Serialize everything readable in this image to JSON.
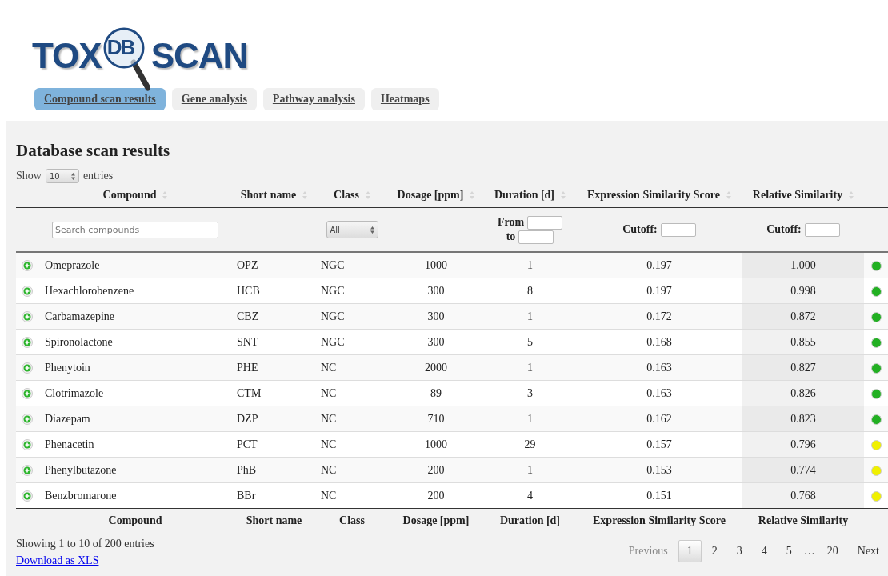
{
  "logo": {
    "left": "TOX",
    "middle": "DB",
    "right": "SCAN"
  },
  "tabs": [
    {
      "label": "Compound scan results",
      "selected": true
    },
    {
      "label": "Gene analysis",
      "selected": false
    },
    {
      "label": "Pathway analysis",
      "selected": false
    },
    {
      "label": "Heatmaps",
      "selected": false
    }
  ],
  "title": "Database scan results",
  "length_menu": {
    "before": "Show",
    "value": "10",
    "after": "entries"
  },
  "table": {
    "columns": [
      "Compound",
      "Short name",
      "Class",
      "Dosage [ppm]",
      "Duration [d]",
      "Expression Similarity Score",
      "Relative Similarity"
    ],
    "filters": {
      "search_placeholder": "Search compounds",
      "class_value": "All",
      "from_label": "From",
      "to_label": "to",
      "cutoff_label_1": "Cutoff:",
      "cutoff_label_2": "Cutoff:"
    },
    "rows": [
      {
        "compound": "Omeprazole",
        "short": "OPZ",
        "class": "NGC",
        "dosage": "1000",
        "duration": "1",
        "score": "0.197",
        "relative": "1.000",
        "color": "#22b022"
      },
      {
        "compound": "Hexachlorobenzene",
        "short": "HCB",
        "class": "NGC",
        "dosage": "300",
        "duration": "8",
        "score": "0.197",
        "relative": "0.998",
        "color": "#22b022"
      },
      {
        "compound": "Carbamazepine",
        "short": "CBZ",
        "class": "NGC",
        "dosage": "300",
        "duration": "1",
        "score": "0.172",
        "relative": "0.872",
        "color": "#22b022"
      },
      {
        "compound": "Spironolactone",
        "short": "SNT",
        "class": "NGC",
        "dosage": "300",
        "duration": "5",
        "score": "0.168",
        "relative": "0.855",
        "color": "#22b022"
      },
      {
        "compound": "Phenytoin",
        "short": "PHE",
        "class": "NC",
        "dosage": "2000",
        "duration": "1",
        "score": "0.163",
        "relative": "0.827",
        "color": "#22b022"
      },
      {
        "compound": "Clotrimazole",
        "short": "CTM",
        "class": "NC",
        "dosage": "89",
        "duration": "3",
        "score": "0.163",
        "relative": "0.826",
        "color": "#22b022"
      },
      {
        "compound": "Diazepam",
        "short": "DZP",
        "class": "NC",
        "dosage": "710",
        "duration": "1",
        "score": "0.162",
        "relative": "0.823",
        "color": "#22b022"
      },
      {
        "compound": "Phenacetin",
        "short": "PCT",
        "class": "NC",
        "dosage": "1000",
        "duration": "29",
        "score": "0.157",
        "relative": "0.796",
        "color": "#f0f000"
      },
      {
        "compound": "Phenylbutazone",
        "short": "PhB",
        "class": "NC",
        "dosage": "200",
        "duration": "1",
        "score": "0.153",
        "relative": "0.774",
        "color": "#f0f000"
      },
      {
        "compound": "Benzbromarone",
        "short": "BBr",
        "class": "NC",
        "dosage": "200",
        "duration": "4",
        "score": "0.151",
        "relative": "0.768",
        "color": "#f0f000"
      }
    ],
    "footer_columns": [
      "Compound",
      "Short name",
      "Class",
      "Dosage [ppm]",
      "Duration [d]",
      "Expression Similarity Score",
      "Relative Similarity"
    ]
  },
  "info": "Showing 1 to 10 of 200 entries",
  "pagination": {
    "previous": {
      "label": "Previous",
      "disabled": true
    },
    "pages": [
      {
        "label": "1",
        "selected": true
      },
      {
        "label": "2",
        "selected": false
      },
      {
        "label": "3",
        "selected": false
      },
      {
        "label": "4",
        "selected": false
      },
      {
        "label": "5",
        "selected": false
      }
    ],
    "ellipsis": "…",
    "last": {
      "label": "20",
      "selected": false
    },
    "next": {
      "label": "Next",
      "disabled": false
    }
  },
  "download_link": "Download as XLS"
}
